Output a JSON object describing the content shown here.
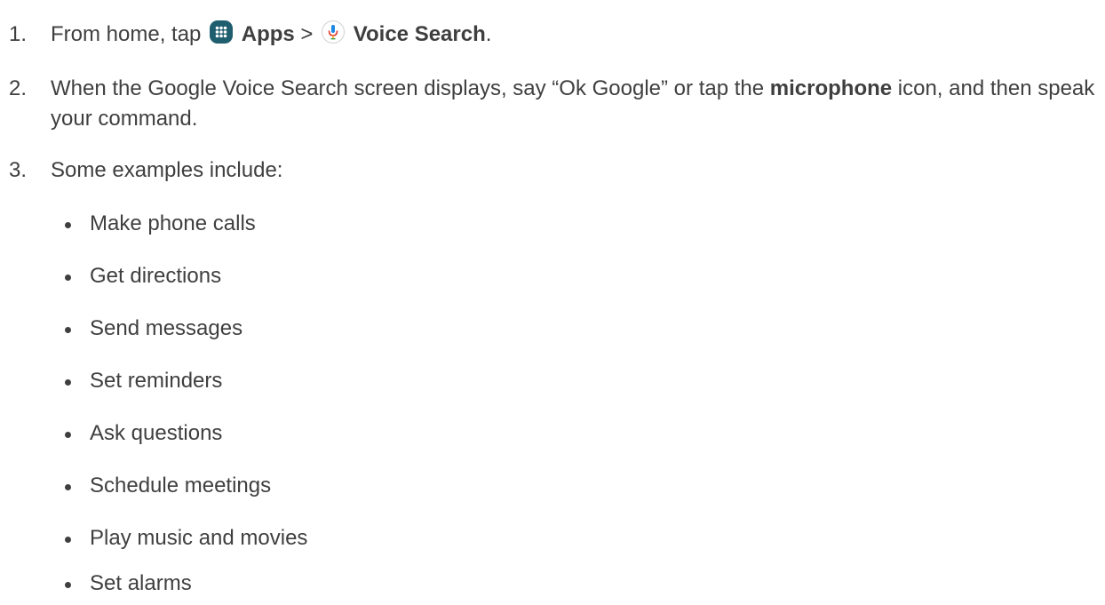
{
  "steps": [
    {
      "number": "1.",
      "parts": {
        "a": "From home, tap",
        "apps_icon": "apps-grid-icon",
        "apps": "Apps",
        "sep": ">",
        "voice_icon": "microphone-icon",
        "voice": "Voice Search",
        "end": "."
      }
    },
    {
      "number": "2.",
      "parts": {
        "a": "When the Google Voice Search screen displays, say “Ok Google” or tap the",
        "b": "microphone",
        "c": "icon, and then speak your command."
      }
    },
    {
      "number": "3.",
      "text": "Some examples include:"
    }
  ],
  "examples": [
    "Make phone calls",
    "Get directions",
    "Send messages",
    "Set reminders",
    "Ask questions",
    "Schedule meetings",
    "Play music and movies",
    "Set alarms"
  ],
  "colors": {
    "text": "#3f3f3f",
    "apps_icon_bg": "#1f5e6e",
    "mic_red": "#e53935",
    "mic_blue": "#1e88e5"
  }
}
